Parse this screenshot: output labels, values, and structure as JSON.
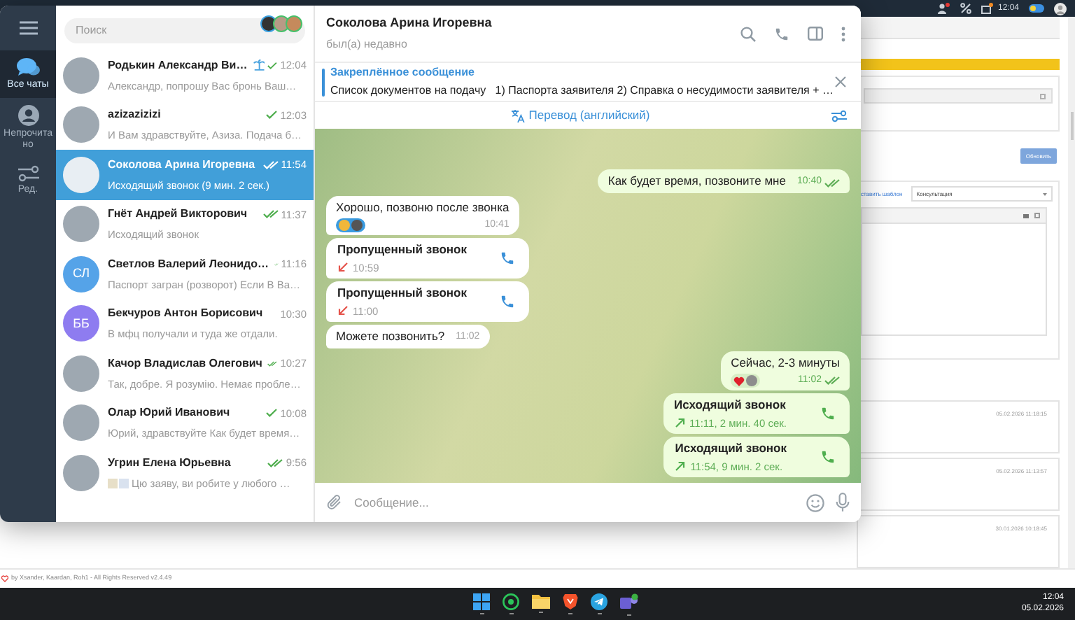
{
  "telegram": {
    "nav": [
      {
        "kind": "folders",
        "label": "Все чаты",
        "selected": true
      },
      {
        "kind": "unread",
        "label": "Непрочитано",
        "selected": false
      },
      {
        "kind": "edit",
        "label": "Ред.",
        "selected": false
      }
    ],
    "search": {
      "placeholder": "Поиск"
    },
    "chats": [
      {
        "name": "Родькин Александр Ви…",
        "preview": "Александр, попрошу Вас бронь Ваш…",
        "time": "12:04",
        "outgoing": true,
        "read": false,
        "emoji_status": true,
        "preview_media": false,
        "selected": false,
        "avatar": {
          "kind": "photo"
        }
      },
      {
        "name": "azizazizizi",
        "preview": "И Вам здравствуйте, Азиза. Подача б…",
        "time": "12:03",
        "outgoing": true,
        "read": false,
        "emoji_status": false,
        "preview_media": false,
        "selected": false,
        "avatar": {
          "kind": "photo"
        }
      },
      {
        "name": "Соколова Арина Игоревна",
        "preview": "Исходящий звонок (9 мин. 2 сек.)",
        "time": "11:54",
        "outgoing": true,
        "read": true,
        "emoji_status": false,
        "preview_media": false,
        "selected": true,
        "avatar": {
          "kind": "photo"
        }
      },
      {
        "name": "Гнёт Андрей Викторович",
        "preview": "Исходящий звонок",
        "time": "11:37",
        "outgoing": true,
        "read": true,
        "emoji_status": false,
        "preview_media": false,
        "selected": false,
        "avatar": {
          "kind": "photo"
        }
      },
      {
        "name": "Светлов Валерий Леонидо…",
        "preview": "Паспорт загран (розворот) Если В Ва…",
        "time": "11:16",
        "outgoing": true,
        "read": true,
        "emoji_status": false,
        "preview_media": false,
        "selected": false,
        "avatar": {
          "kind": "initials",
          "text": "СЛ",
          "color": "#55a3e8"
        }
      },
      {
        "name": "Бекчуров Антон Борисович",
        "preview": "В мфц получали и туда же отдали.",
        "time": "10:30",
        "outgoing": false,
        "emoji_status": false,
        "preview_media": false,
        "selected": false,
        "avatar": {
          "kind": "initials",
          "text": "ББ",
          "color": "#8e7cf0"
        }
      },
      {
        "name": "Качор Владислав Олегович",
        "preview": "Так, добре. Я розумію. Немає пробле…",
        "time": "10:27",
        "outgoing": true,
        "read": true,
        "emoji_status": false,
        "preview_media": false,
        "selected": false,
        "avatar": {
          "kind": "photo"
        }
      },
      {
        "name": "Олар Юрий Иванович",
        "preview": "Юрий, здравствуйте Как будет время…",
        "time": "10:08",
        "outgoing": true,
        "read": false,
        "emoji_status": false,
        "preview_media": false,
        "selected": false,
        "avatar": {
          "kind": "photo"
        }
      },
      {
        "name": "Угрин Елена Юрьевна",
        "preview": "Цю заяву, ви робите у любого …",
        "time": "9:56",
        "outgoing": true,
        "read": true,
        "emoji_status": false,
        "preview_media": true,
        "selected": false,
        "avatar": {
          "kind": "photo"
        }
      }
    ],
    "chat": {
      "title": "Соколова Арина Игоревна",
      "status": "был(а) недавно",
      "pinned": {
        "label": "Закреплённое сообщение",
        "text": "Список документов на подачу   1) Паспорта заявителя 2) Справка о несудимости заявителя + …"
      },
      "translate": "Перевод (английский)",
      "messages": [
        {
          "kind": "text",
          "outgoing": true,
          "text": "Как будет время, позвоните мне",
          "time": "10:40",
          "read": true
        },
        {
          "kind": "text",
          "outgoing": false,
          "text": "Хорошо, позвоню после звонка",
          "time": "10:41",
          "reactions": [
            {
              "kind": "emoji"
            },
            {
              "kind": "avatar"
            }
          ]
        },
        {
          "kind": "call",
          "outgoing": false,
          "title": "Пропущенный звонок",
          "detail": "10:59",
          "missed": true
        },
        {
          "kind": "call",
          "outgoing": false,
          "title": "Пропущенный звонок",
          "detail": "11:00",
          "missed": true
        },
        {
          "kind": "text",
          "outgoing": false,
          "text": "Можете позвонить?",
          "time": "11:02"
        },
        {
          "kind": "text",
          "outgoing": true,
          "text": "Сейчас, 2-3 минуты",
          "time": "11:02",
          "read": true,
          "reactions": [
            {
              "kind": "heart"
            },
            {
              "kind": "avatar"
            }
          ]
        },
        {
          "kind": "call",
          "outgoing": true,
          "title": "Исходящий звонок",
          "detail": "11:11, 2 мин. 40 сек.",
          "missed": false
        },
        {
          "kind": "call",
          "outgoing": true,
          "title": "Исходящий звонок",
          "detail": "11:54, 9 мин. 2 сек.",
          "missed": false
        }
      ],
      "input": {
        "placeholder": "Сообщение..."
      }
    }
  },
  "page": {
    "top_bar": {
      "time": "12:04",
      "toggle_on": true
    },
    "template_link": "ставить шаблон",
    "select_value": "Консультация",
    "button": "Обновить",
    "entries": [
      {
        "date": "05.02.2026 11:18:15"
      },
      {
        "date": "05.02.2026 11:13:57"
      },
      {
        "date": "30.01.2026 10:18:45"
      }
    ],
    "footer": "by Xsander, Kaardan, Roh1 - All Rights Reserved v2.4.49"
  },
  "taskbar": {
    "apps": [
      {
        "kind": "windows"
      },
      {
        "kind": "whatsapp"
      },
      {
        "kind": "folder"
      },
      {
        "kind": "brave"
      },
      {
        "kind": "telegram"
      },
      {
        "kind": "teams"
      }
    ],
    "time": "12:04",
    "date": "05.02.2026"
  }
}
